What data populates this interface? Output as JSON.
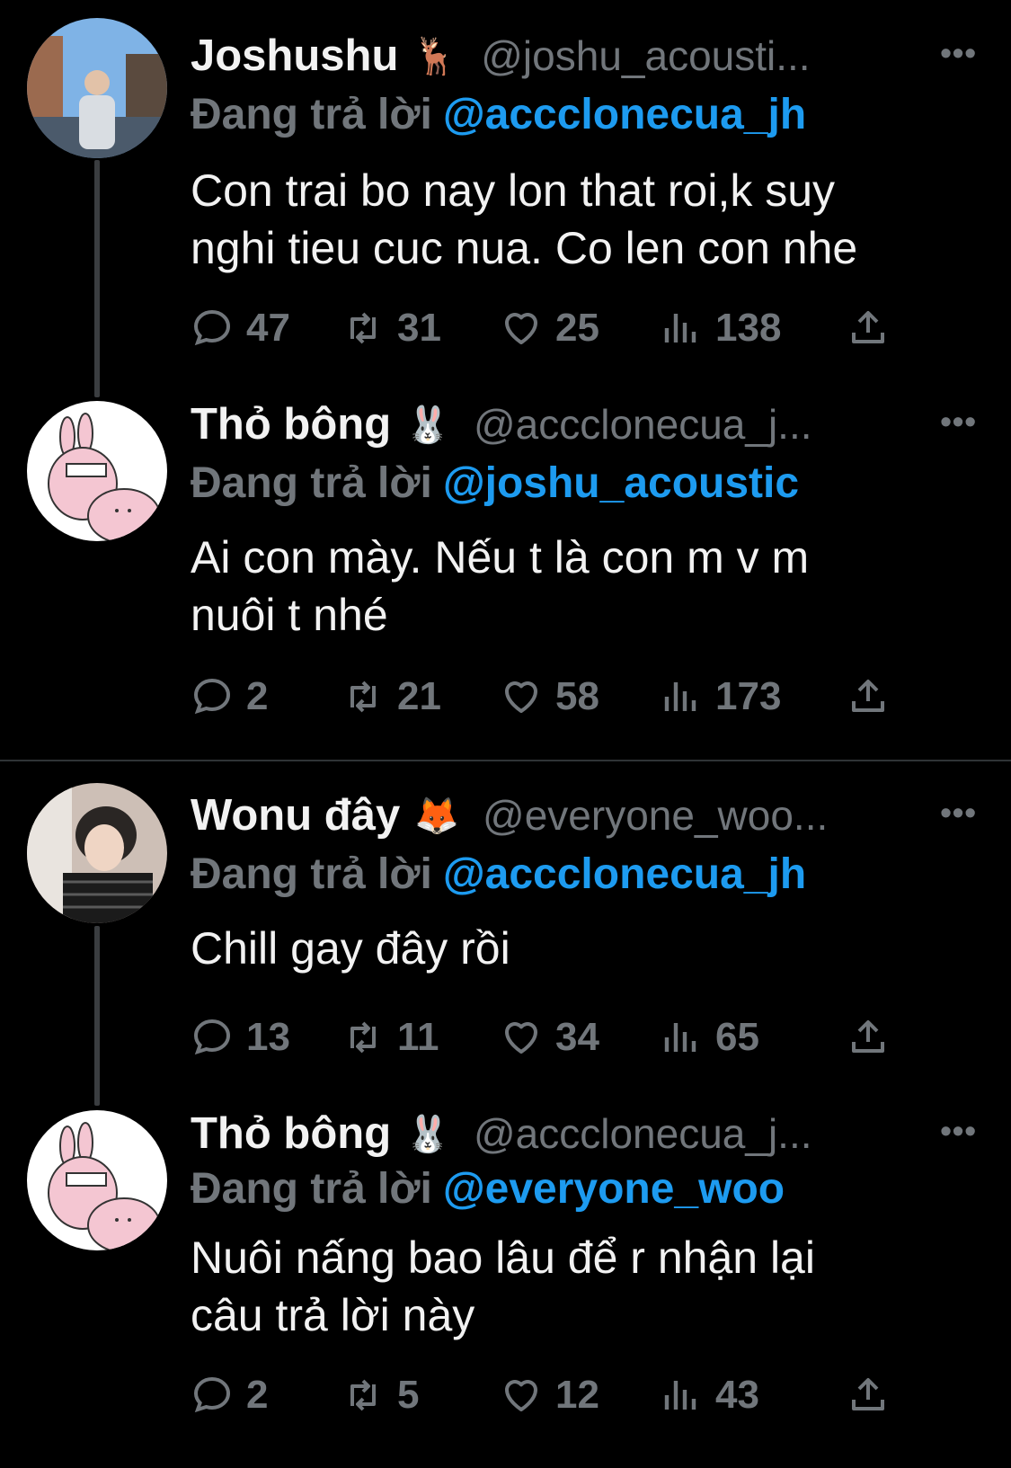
{
  "reply_prefix": "Đang trả lời",
  "tweets": [
    {
      "name": "Joshushu",
      "emoji": "🦌",
      "handle": "@joshu_acousti...",
      "reply_to": "@accclonecua_jh",
      "text_lines": [
        "Con trai bo nay lon that roi,k suy",
        "nghi tieu cuc nua. Co len con nhe"
      ],
      "replies": "47",
      "retweets": "31",
      "likes": "25",
      "views": "138"
    },
    {
      "name": "Thỏ bông",
      "emoji": "🐰",
      "handle": "@accclonecua_j...",
      "reply_to": "@joshu_acoustic",
      "text_lines": [
        "Ai con mày. Nếu t là con m v m",
        "nuôi t nhé"
      ],
      "replies": "2",
      "retweets": "21",
      "likes": "58",
      "views": "173"
    },
    {
      "name": "Wonu đây",
      "emoji": "🦊",
      "handle": "@everyone_woo...",
      "reply_to": "@accclonecua_jh",
      "text_lines": [
        "Chill gay đây rồi"
      ],
      "replies": "13",
      "retweets": "11",
      "likes": "34",
      "views": "65"
    },
    {
      "name": "Thỏ bông",
      "emoji": "🐰",
      "handle": "@accclonecua_j...",
      "reply_to": "@everyone_woo",
      "text_lines": [
        "Nuôi nấng bao lâu để r nhận lại",
        "câu trả lời này"
      ],
      "replies": "2",
      "retweets": "5",
      "likes": "12",
      "views": "43"
    }
  ]
}
